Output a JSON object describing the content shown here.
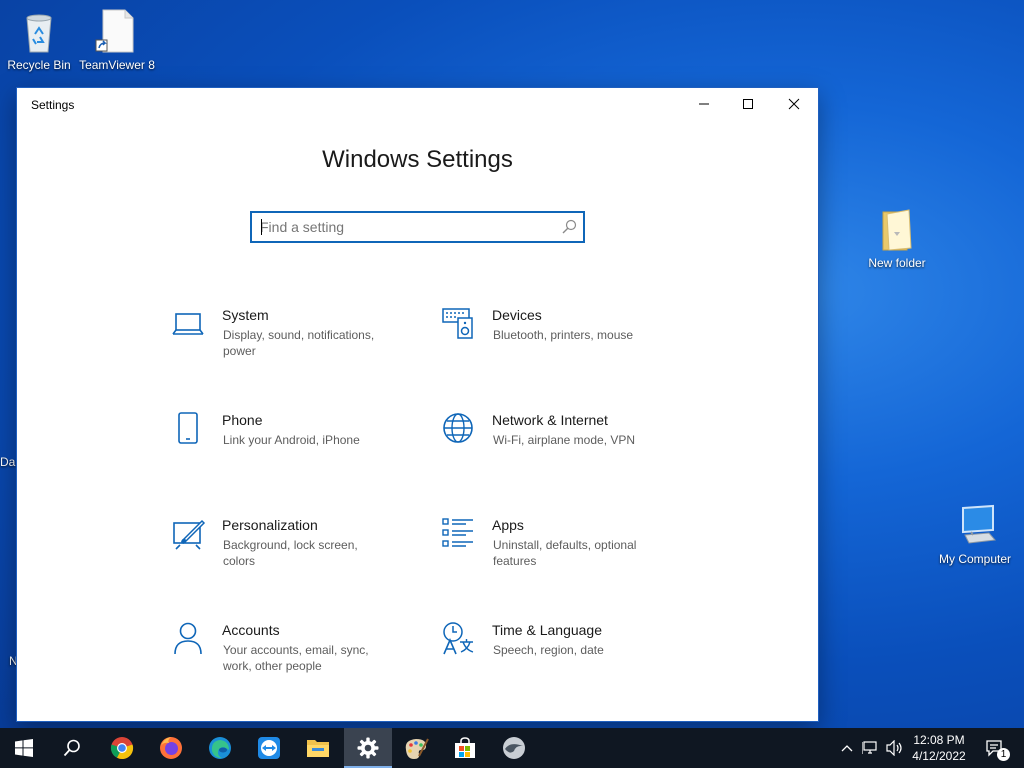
{
  "desktop": {
    "icons": [
      {
        "label": "Recycle Bin"
      },
      {
        "label": "TeamViewer 8"
      },
      {
        "label": "New folder"
      },
      {
        "label": "My Computer"
      }
    ],
    "edge_fragment_left": "Da",
    "edge_fragment_left2": "N"
  },
  "window": {
    "title": "Settings",
    "heading": "Windows Settings",
    "search": {
      "placeholder": "Find a setting",
      "value": ""
    },
    "tiles": [
      {
        "name": "System",
        "desc": "Display, sound, notifications, power",
        "icon": "laptop-icon"
      },
      {
        "name": "Devices",
        "desc": "Bluetooth, printers, mouse",
        "icon": "keyboard-speaker-icon"
      },
      {
        "name": "Phone",
        "desc": "Link your Android, iPhone",
        "icon": "phone-icon"
      },
      {
        "name": "Network & Internet",
        "desc": "Wi-Fi, airplane mode, VPN",
        "icon": "globe-icon"
      },
      {
        "name": "Personalization",
        "desc": "Background, lock screen, colors",
        "icon": "paint-icon"
      },
      {
        "name": "Apps",
        "desc": "Uninstall, defaults, optional features",
        "icon": "apps-list-icon"
      },
      {
        "name": "Accounts",
        "desc": "Your accounts, email, sync, work, other people",
        "icon": "person-icon"
      },
      {
        "name": "Time & Language",
        "desc": "Speech, region, date",
        "icon": "time-language-icon"
      }
    ]
  },
  "taskbar": {
    "apps": [
      "start",
      "search",
      "chrome",
      "firefox",
      "edge",
      "teamviewer",
      "file-explorer",
      "settings",
      "paint",
      "store",
      "app"
    ],
    "active_app": "settings",
    "clock": {
      "time": "12:08 PM",
      "date": "4/12/2022"
    },
    "notification_count": "1"
  },
  "colors": {
    "accent": "#0f66b8",
    "desktop": "#0a4fbb",
    "taskbar": "#0f1722"
  }
}
